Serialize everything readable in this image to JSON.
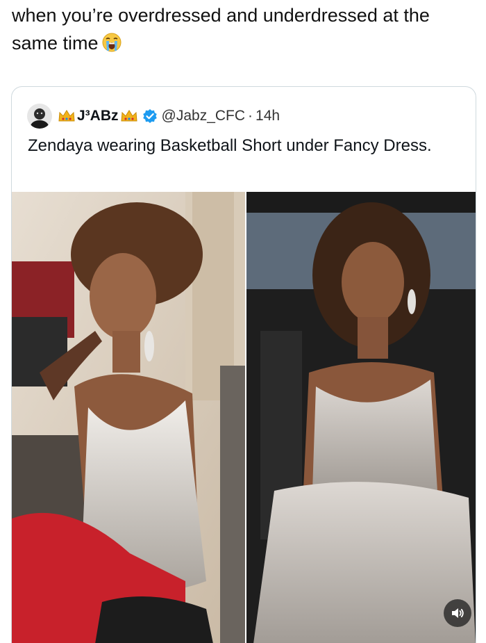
{
  "post": {
    "caption": "when you’re overdressed and underdressed at the same time",
    "caption_emoji": "loudly-crying-face-icon"
  },
  "quoted_tweet": {
    "display_name": "J³ABz",
    "handle": "@Jabz_CFC",
    "separator": "·",
    "time": "14h",
    "verified": true,
    "verified_color": "#1d9bf0",
    "text": "Zendaya wearing Basketball Short under Fancy Dress.",
    "media": [
      {
        "name": "photo-left",
        "description_icon": "photo"
      },
      {
        "name": "photo-right",
        "description_icon": "photo"
      }
    ],
    "volume_icon": "speaker-volume-icon"
  }
}
